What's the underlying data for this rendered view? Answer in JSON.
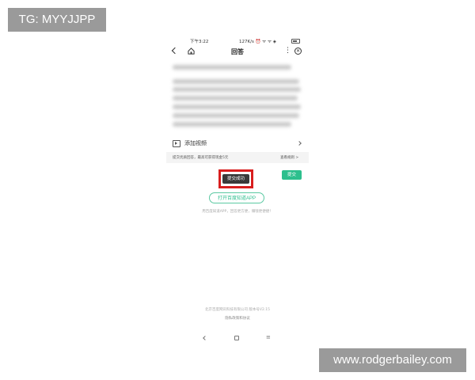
{
  "watermarks": {
    "top_left": "TG: MYYJJPP",
    "bottom_right": "www.rodgerbailey.com"
  },
  "status_bar": {
    "time": "下午3:22",
    "indicators": "127K/s ⏰ ᯤ ᯤ ◈"
  },
  "nav": {
    "title": "回答",
    "more": "⋮",
    "close": "✕"
  },
  "add_video": {
    "label": "添加视频"
  },
  "reward_bar": {
    "text": "提交优质回答，最高可获得现金5元",
    "link": "查看规则 >"
  },
  "submit": {
    "label": "提交"
  },
  "toast": {
    "message": "提交成功"
  },
  "open_app": {
    "label": "打开百度知道APP"
  },
  "tagline": "用百度知道APP，回答更方便，赚钱更便捷！",
  "footer": {
    "company": "北京百度网讯科技有限公司 版本号V2.15",
    "privacy": "隐私政策和协议"
  },
  "colors": {
    "accent_green": "#2dbf8d",
    "highlight_red": "#d81e1e",
    "watermark_gray": "#9a9a9a"
  }
}
